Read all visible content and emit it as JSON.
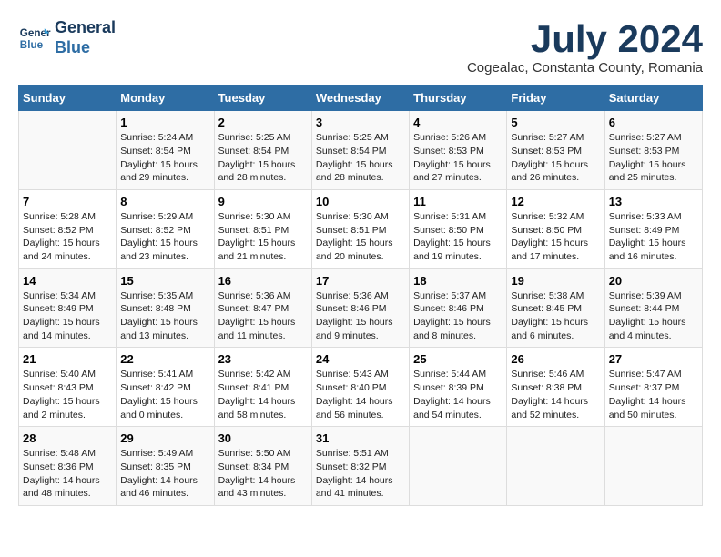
{
  "logo": {
    "line1": "General",
    "line2": "Blue"
  },
  "title": "July 2024",
  "location": "Cogealac, Constanta County, Romania",
  "days_of_week": [
    "Sunday",
    "Monday",
    "Tuesday",
    "Wednesday",
    "Thursday",
    "Friday",
    "Saturday"
  ],
  "rows": [
    [
      {
        "day": "",
        "info": ""
      },
      {
        "day": "1",
        "info": "Sunrise: 5:24 AM\nSunset: 8:54 PM\nDaylight: 15 hours\nand 29 minutes."
      },
      {
        "day": "2",
        "info": "Sunrise: 5:25 AM\nSunset: 8:54 PM\nDaylight: 15 hours\nand 28 minutes."
      },
      {
        "day": "3",
        "info": "Sunrise: 5:25 AM\nSunset: 8:54 PM\nDaylight: 15 hours\nand 28 minutes."
      },
      {
        "day": "4",
        "info": "Sunrise: 5:26 AM\nSunset: 8:53 PM\nDaylight: 15 hours\nand 27 minutes."
      },
      {
        "day": "5",
        "info": "Sunrise: 5:27 AM\nSunset: 8:53 PM\nDaylight: 15 hours\nand 26 minutes."
      },
      {
        "day": "6",
        "info": "Sunrise: 5:27 AM\nSunset: 8:53 PM\nDaylight: 15 hours\nand 25 minutes."
      }
    ],
    [
      {
        "day": "7",
        "info": "Sunrise: 5:28 AM\nSunset: 8:52 PM\nDaylight: 15 hours\nand 24 minutes."
      },
      {
        "day": "8",
        "info": "Sunrise: 5:29 AM\nSunset: 8:52 PM\nDaylight: 15 hours\nand 23 minutes."
      },
      {
        "day": "9",
        "info": "Sunrise: 5:30 AM\nSunset: 8:51 PM\nDaylight: 15 hours\nand 21 minutes."
      },
      {
        "day": "10",
        "info": "Sunrise: 5:30 AM\nSunset: 8:51 PM\nDaylight: 15 hours\nand 20 minutes."
      },
      {
        "day": "11",
        "info": "Sunrise: 5:31 AM\nSunset: 8:50 PM\nDaylight: 15 hours\nand 19 minutes."
      },
      {
        "day": "12",
        "info": "Sunrise: 5:32 AM\nSunset: 8:50 PM\nDaylight: 15 hours\nand 17 minutes."
      },
      {
        "day": "13",
        "info": "Sunrise: 5:33 AM\nSunset: 8:49 PM\nDaylight: 15 hours\nand 16 minutes."
      }
    ],
    [
      {
        "day": "14",
        "info": "Sunrise: 5:34 AM\nSunset: 8:49 PM\nDaylight: 15 hours\nand 14 minutes."
      },
      {
        "day": "15",
        "info": "Sunrise: 5:35 AM\nSunset: 8:48 PM\nDaylight: 15 hours\nand 13 minutes."
      },
      {
        "day": "16",
        "info": "Sunrise: 5:36 AM\nSunset: 8:47 PM\nDaylight: 15 hours\nand 11 minutes."
      },
      {
        "day": "17",
        "info": "Sunrise: 5:36 AM\nSunset: 8:46 PM\nDaylight: 15 hours\nand 9 minutes."
      },
      {
        "day": "18",
        "info": "Sunrise: 5:37 AM\nSunset: 8:46 PM\nDaylight: 15 hours\nand 8 minutes."
      },
      {
        "day": "19",
        "info": "Sunrise: 5:38 AM\nSunset: 8:45 PM\nDaylight: 15 hours\nand 6 minutes."
      },
      {
        "day": "20",
        "info": "Sunrise: 5:39 AM\nSunset: 8:44 PM\nDaylight: 15 hours\nand 4 minutes."
      }
    ],
    [
      {
        "day": "21",
        "info": "Sunrise: 5:40 AM\nSunset: 8:43 PM\nDaylight: 15 hours\nand 2 minutes."
      },
      {
        "day": "22",
        "info": "Sunrise: 5:41 AM\nSunset: 8:42 PM\nDaylight: 15 hours\nand 0 minutes."
      },
      {
        "day": "23",
        "info": "Sunrise: 5:42 AM\nSunset: 8:41 PM\nDaylight: 14 hours\nand 58 minutes."
      },
      {
        "day": "24",
        "info": "Sunrise: 5:43 AM\nSunset: 8:40 PM\nDaylight: 14 hours\nand 56 minutes."
      },
      {
        "day": "25",
        "info": "Sunrise: 5:44 AM\nSunset: 8:39 PM\nDaylight: 14 hours\nand 54 minutes."
      },
      {
        "day": "26",
        "info": "Sunrise: 5:46 AM\nSunset: 8:38 PM\nDaylight: 14 hours\nand 52 minutes."
      },
      {
        "day": "27",
        "info": "Sunrise: 5:47 AM\nSunset: 8:37 PM\nDaylight: 14 hours\nand 50 minutes."
      }
    ],
    [
      {
        "day": "28",
        "info": "Sunrise: 5:48 AM\nSunset: 8:36 PM\nDaylight: 14 hours\nand 48 minutes."
      },
      {
        "day": "29",
        "info": "Sunrise: 5:49 AM\nSunset: 8:35 PM\nDaylight: 14 hours\nand 46 minutes."
      },
      {
        "day": "30",
        "info": "Sunrise: 5:50 AM\nSunset: 8:34 PM\nDaylight: 14 hours\nand 43 minutes."
      },
      {
        "day": "31",
        "info": "Sunrise: 5:51 AM\nSunset: 8:32 PM\nDaylight: 14 hours\nand 41 minutes."
      },
      {
        "day": "",
        "info": ""
      },
      {
        "day": "",
        "info": ""
      },
      {
        "day": "",
        "info": ""
      }
    ]
  ]
}
